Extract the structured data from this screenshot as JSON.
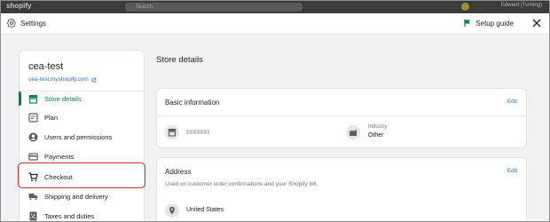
{
  "topbar": {
    "logo": "shopify",
    "search_placeholder": "Search",
    "user": "Edward (Turning)"
  },
  "header": {
    "title": "Settings",
    "setup_guide": "Setup guide"
  },
  "sidebar": {
    "store_name": "cea-test",
    "store_url": "cea-test.myshopify.com",
    "items": [
      {
        "label": "Store details",
        "icon": "store-icon",
        "active": true
      },
      {
        "label": "Plan",
        "icon": "plan-icon"
      },
      {
        "label": "Users and permissions",
        "icon": "user-icon"
      },
      {
        "label": "Payments",
        "icon": "payments-icon"
      },
      {
        "label": "Checkout",
        "icon": "cart-icon",
        "highlighted": true
      },
      {
        "label": "Shipping and delivery",
        "icon": "truck-icon"
      },
      {
        "label": "Taxes and duties",
        "icon": "tax-icon"
      }
    ]
  },
  "main": {
    "title": "Store details",
    "basic_info": {
      "title": "Basic information",
      "edit": "Edit",
      "industry_label": "Industry",
      "industry_value": "Other"
    },
    "address": {
      "title": "Address",
      "edit": "Edit",
      "subtitle": "Used on customer order confirmations and your Shopify bill.",
      "country": "United States"
    }
  },
  "colors": {
    "accent": "#008060",
    "link": "#2c6ecb",
    "highlight": "#e0262b"
  }
}
